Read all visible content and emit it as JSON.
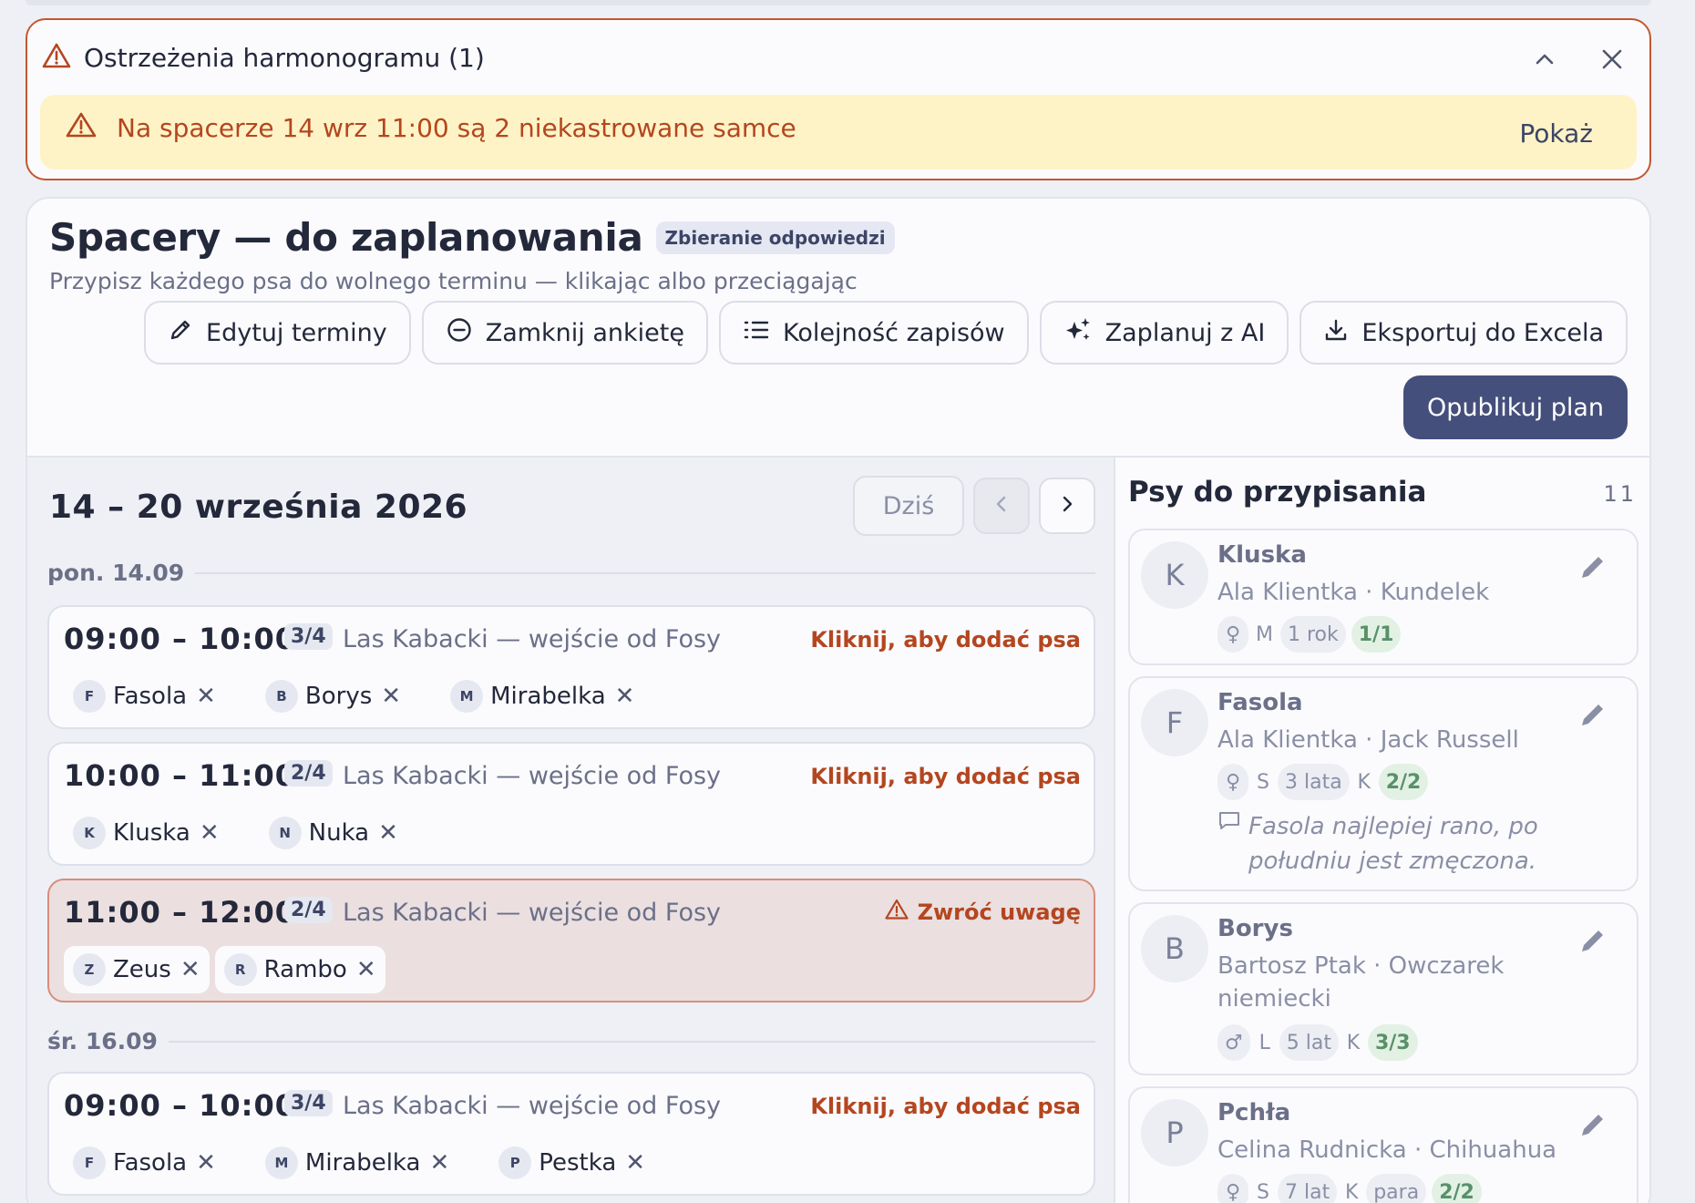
{
  "warnings": {
    "title": "Ostrzeżenia harmonogramu (1)",
    "items": [
      {
        "message": "Na spacerze 14 wrz 11:00 są 2 niekastrowane samce",
        "action": "Pokaż"
      }
    ]
  },
  "header": {
    "title": "Spacery — do zaplanowania",
    "status": "Zbieranie odpowiedzi",
    "subtitle": "Przypisz każdego psa do wolnego terminu — klikając albo przeciągając"
  },
  "toolbar": {
    "edit": "Edytuj terminy",
    "close": "Zamknij ankietę",
    "order": "Kolejność zapisów",
    "ai": "Zaplanuj z AI",
    "export": "Eksportuj do Excela",
    "publish": "Opublikuj plan"
  },
  "calendar": {
    "week": "14 – 20 września 2026",
    "today": "Dziś",
    "add_label": "Kliknij, aby dodać psa",
    "attention_label": "Zwróć uwagę",
    "days": [
      {
        "label": "pon. 14.09",
        "slots": [
          {
            "time": "09:00 – 10:00",
            "cap": "3/4",
            "location": "Las Kabacki — wejście od Fosy",
            "dogs": [
              {
                "ini": "F",
                "name": "Fasola"
              },
              {
                "ini": "B",
                "name": "Borys"
              },
              {
                "ini": "M",
                "name": "Mirabelka"
              }
            ]
          },
          {
            "time": "10:00 – 11:00",
            "cap": "2/4",
            "location": "Las Kabacki — wejście od Fosy",
            "dogs": [
              {
                "ini": "K",
                "name": "Kluska"
              },
              {
                "ini": "N",
                "name": "Nuka"
              }
            ]
          },
          {
            "time": "11:00 – 12:00",
            "cap": "2/4",
            "location": "Las Kabacki — wejście od Fosy",
            "dogs": [
              {
                "ini": "Z",
                "name": "Zeus"
              },
              {
                "ini": "R",
                "name": "Rambo"
              }
            ]
          }
        ]
      },
      {
        "label": "śr. 16.09",
        "slots": [
          {
            "time": "09:00 – 10:00",
            "cap": "3/4",
            "location": "Las Kabacki — wejście od Fosy",
            "dogs": [
              {
                "ini": "F",
                "name": "Fasola"
              },
              {
                "ini": "M",
                "name": "Mirabelka"
              },
              {
                "ini": "P",
                "name": "Pestka"
              }
            ]
          }
        ]
      }
    ]
  },
  "sidebar": {
    "title": "Psy do przypisania",
    "count": "11",
    "dogs": [
      {
        "ini": "K",
        "name": "Kluska",
        "owner": "Ala Klientka · Kundelek",
        "sex": "♀",
        "size": "M",
        "age": "1 rok",
        "k": "",
        "pair": "",
        "score": "1/1",
        "note": ""
      },
      {
        "ini": "F",
        "name": "Fasola",
        "owner": "Ala Klientka · Jack Russell",
        "sex": "♀",
        "size": "S",
        "age": "3 lata",
        "k": "K",
        "pair": "",
        "score": "2/2",
        "note": "Fasola najlepiej rano, po południu jest zmęczona."
      },
      {
        "ini": "B",
        "name": "Borys",
        "owner": "Bartosz Ptak · Owczarek niemiecki",
        "sex": "♂",
        "size": "L",
        "age": "5 lat",
        "k": "K",
        "pair": "",
        "score": "3/3",
        "note": ""
      },
      {
        "ini": "P",
        "name": "Pchła",
        "owner": "Celina Rudnicka · Chihuahua",
        "sex": "♀",
        "size": "S",
        "age": "7 lat",
        "k": "K",
        "pair": "para",
        "score": "2/2",
        "note": ""
      }
    ]
  },
  "colors": {
    "accent": "#454f7c",
    "warning": "#b4461f",
    "warning_bg": "#fef3c6",
    "alert_slot_bg": "#ebdfe0",
    "ok": "#58906a"
  }
}
